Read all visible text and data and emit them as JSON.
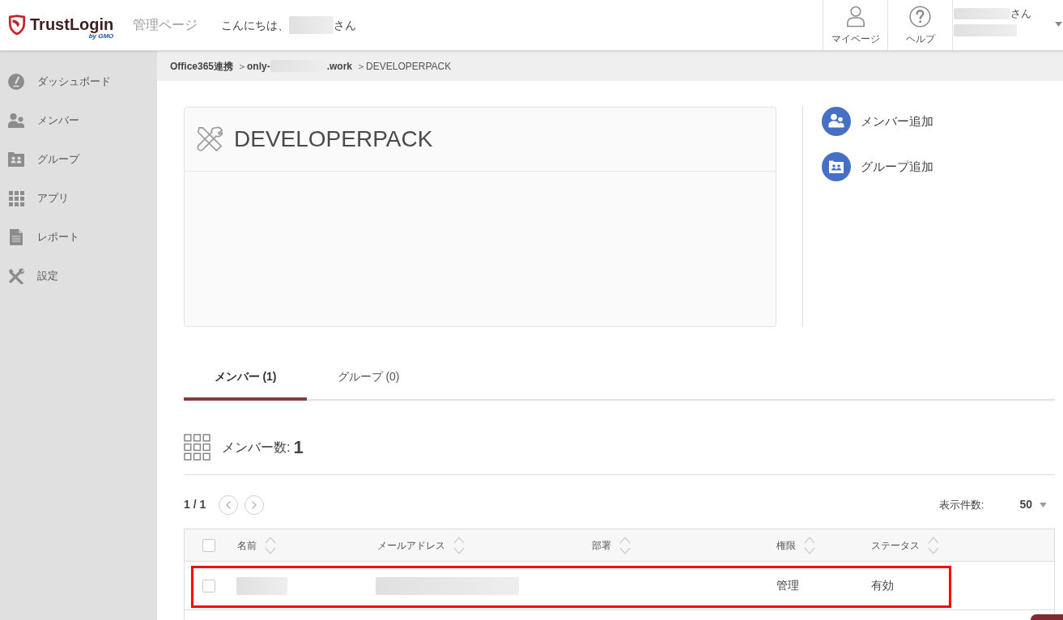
{
  "header": {
    "logo": {
      "name": "TrustLogin",
      "byline": "by GMO"
    },
    "section_title": "管理ページ",
    "greeting": [
      {
        "kind": "text",
        "text": "こんにちは、"
      },
      {
        "kind": "redacted"
      },
      {
        "kind": "text",
        "text": "さん"
      }
    ],
    "nav_buttons": [
      {
        "label": "マイページ"
      },
      {
        "label": "ヘルプ"
      }
    ],
    "user": {
      "lines": [
        [
          {
            "kind": "redacted"
          },
          {
            "kind": "text",
            "text": "さん"
          }
        ],
        [
          {
            "kind": "redacted"
          }
        ]
      ]
    }
  },
  "sidebar": {
    "items": [
      {
        "label": "ダッシュボード"
      },
      {
        "label": "メンバー"
      },
      {
        "label": "グループ"
      },
      {
        "label": "アプリ"
      },
      {
        "label": "レポート"
      },
      {
        "label": "設定"
      }
    ]
  },
  "breadcrumb": [
    {
      "kind": "link",
      "text": "Office365連携"
    },
    {
      "kind": "separator",
      "text": "＞"
    },
    {
      "kind": "link",
      "text": "only-"
    },
    {
      "kind": "redacted"
    },
    {
      "kind": "link",
      "text": ".work"
    },
    {
      "kind": "separator",
      "text": "＞"
    },
    {
      "kind": "current",
      "text": "DEVELOPERPACK"
    }
  ],
  "card": {
    "title": "DEVELOPERPACK"
  },
  "actions": [
    {
      "label": "メンバー追加"
    },
    {
      "label": "グループ追加"
    }
  ],
  "tabs": [
    {
      "label": "メンバー (1)",
      "selected": true
    },
    {
      "label": "グループ (0)",
      "selected": false
    }
  ],
  "member_count": {
    "label": "メンバー数:",
    "value": "1"
  },
  "pagination": {
    "page": "1 / 1",
    "per_page_label": "表示件数:",
    "per_page": "50"
  },
  "member_table": {
    "select_all_checked": false,
    "columns": [
      "名前",
      "メールアドレス",
      "部署",
      "権限",
      "ステータス"
    ],
    "rows": [
      {
        "checked": false,
        "highlighted": true,
        "cells": [
          {
            "kind": "redacted"
          },
          {
            "kind": "redacted"
          },
          {
            "kind": "empty"
          },
          {
            "kind": "text",
            "text": "管理"
          },
          {
            "kind": "text",
            "text": "有効"
          }
        ]
      }
    ]
  }
}
